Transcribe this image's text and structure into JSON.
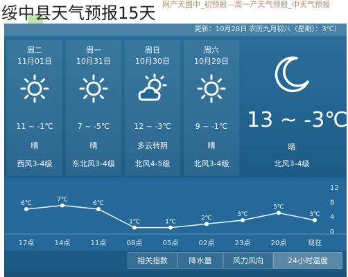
{
  "page": {
    "title": "绥中县天气预报15天",
    "top_link": "网产天国中_初预报—周一产天气预报_中天气预报",
    "info_bar": "更新：10月28日 农历九月初八（星期）：3℃）"
  },
  "days": [
    {
      "name": "周二",
      "date": "11月01日",
      "icon": "sun-icon",
      "temp": "11 ~ -1℃",
      "cond": "晴",
      "wind": "西风3-4级"
    },
    {
      "name": "周一",
      "date": "10月31日",
      "icon": "sun-icon",
      "temp": "7 ~ -5℃",
      "cond": "晴",
      "wind": "东北风3-4级"
    },
    {
      "name": "周日",
      "date": "10月30日",
      "icon": "partly-cloudy-icon",
      "temp": "12 ~ -3℃",
      "cond": "多云转阴",
      "wind": "北风4-5级"
    },
    {
      "name": "周六",
      "date": "10月29日",
      "icon": "sun-icon",
      "temp": "9 ~ -1℃",
      "cond": "晴",
      "wind": "北风3-4级"
    }
  ],
  "today": {
    "icon": "moon-icon",
    "temp": "13 ~ -3℃",
    "cond": "晴",
    "wind": "北风3-4级"
  },
  "chart_data": {
    "type": "line",
    "title": "",
    "x": [
      "17点",
      "14点",
      "11点",
      "08点",
      "05点",
      "02点",
      "23点",
      "20点",
      "现在"
    ],
    "series": [
      {
        "name": "",
        "values": [
          6,
          7,
          6,
          1,
          1,
          2,
          3,
          5,
          3
        ]
      }
    ],
    "labels": [
      "6℃",
      "7℃",
      "6℃",
      "1℃",
      "1℃",
      "2℃",
      "3℃",
      "5℃",
      "3℃"
    ],
    "yticks": [
      12,
      8,
      4,
      0
    ],
    "ylim": [
      0,
      12
    ],
    "grid": false
  },
  "tabs": [
    "相关指数",
    "降水量",
    "风力风向",
    "24小时温度"
  ],
  "colors": {
    "panel": "#1f6794",
    "line": "#f2f6f9",
    "accent": "#ffffff"
  }
}
